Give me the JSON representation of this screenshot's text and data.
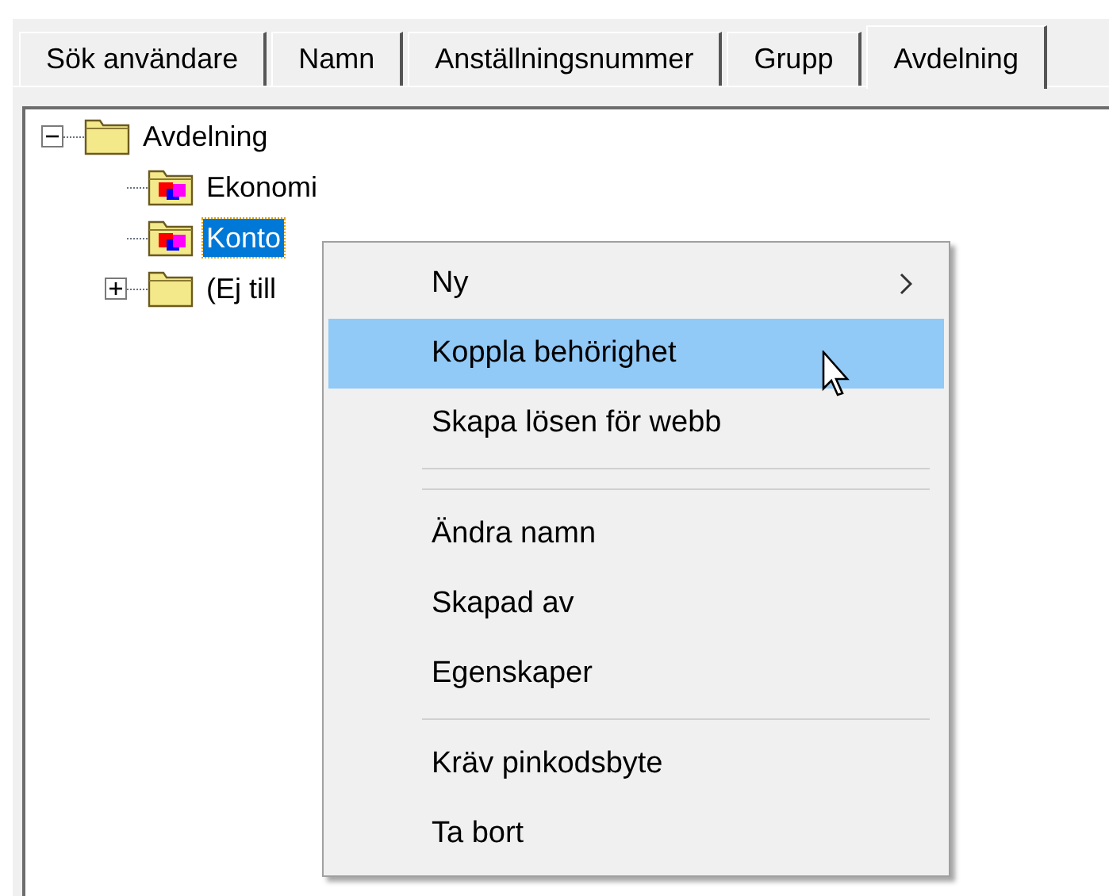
{
  "tabs": [
    {
      "label": "Sök användare",
      "selected": false
    },
    {
      "label": "Namn",
      "selected": false
    },
    {
      "label": "Anställningsnummer",
      "selected": false
    },
    {
      "label": "Grupp",
      "selected": false
    },
    {
      "label": "Avdelning",
      "selected": true
    }
  ],
  "tree": [
    {
      "label": "Avdelning",
      "expanded": true,
      "kind": "plain",
      "selected": false,
      "children": [
        {
          "label": "Ekonomi",
          "kind": "colored",
          "selected": false
        },
        {
          "label": "Konto",
          "kind": "colored",
          "selected": true
        },
        {
          "label": "(Ej till",
          "kind": "plain",
          "expanded": false,
          "selected": false
        }
      ]
    }
  ],
  "context_menu": [
    {
      "kind": "item",
      "label": "Ny",
      "submenu": true,
      "selected": false
    },
    {
      "kind": "item",
      "label": "Koppla behörighet",
      "submenu": false,
      "selected": true
    },
    {
      "kind": "item",
      "label": "Skapa lösen för webb",
      "submenu": false,
      "selected": false
    },
    {
      "kind": "separator"
    },
    {
      "kind": "separator"
    },
    {
      "kind": "item",
      "label": "Ändra namn",
      "submenu": false,
      "selected": false
    },
    {
      "kind": "item",
      "label": "Skapad av",
      "submenu": false,
      "selected": false
    },
    {
      "kind": "item",
      "label": "Egenskaper",
      "submenu": false,
      "selected": false
    },
    {
      "kind": "separator"
    },
    {
      "kind": "item",
      "label": "Kräv pinkodsbyte",
      "submenu": false,
      "selected": false
    },
    {
      "kind": "item",
      "label": "Ta bort",
      "submenu": false,
      "selected": false
    }
  ]
}
